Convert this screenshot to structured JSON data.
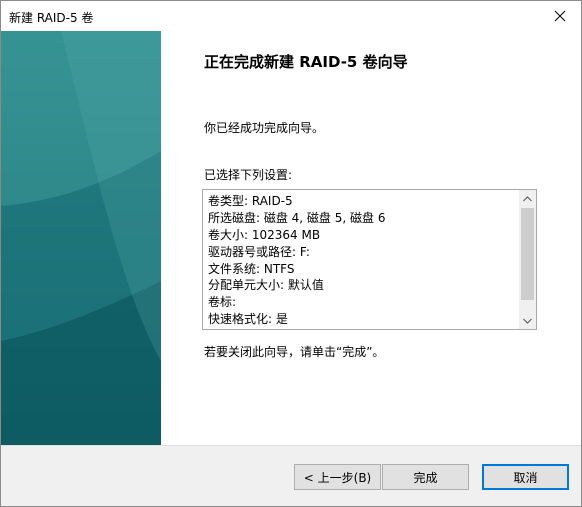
{
  "window": {
    "title": "新建 RAID-5 卷"
  },
  "main": {
    "heading": "正在完成新建 RAID-5 卷向导",
    "success_text": "你已经成功完成向导。",
    "settings_label": "已选择下列设置:",
    "settings": [
      "卷类型: RAID-5",
      "所选磁盘: 磁盘 4, 磁盘 5, 磁盘 6",
      "卷大小: 102364 MB",
      "驱动器号或路径: F:",
      "文件系统: NTFS",
      "分配单元大小: 默认值",
      "卷标:",
      "快速格式化: 是"
    ],
    "close_hint": "若要关闭此向导，请单击“完成”。"
  },
  "buttons": {
    "back": "< 上一步(B)",
    "finish": "完成",
    "cancel": "取消"
  },
  "colors": {
    "banner_top": "#2d8a8c",
    "banner_bottom": "#0f5f66",
    "default_button_border": "#0078d7"
  },
  "icons": {
    "close": "close-icon",
    "scroll_up": "chevron-up-icon",
    "scroll_down": "chevron-down-icon"
  }
}
